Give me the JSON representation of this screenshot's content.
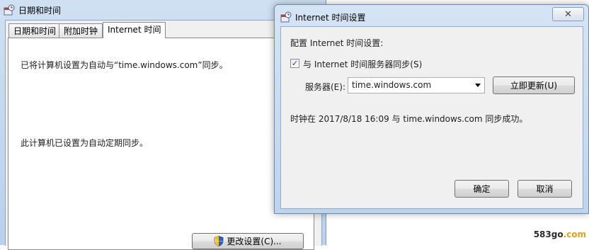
{
  "back_window": {
    "title": "日期和时间",
    "tabs": [
      {
        "label": "日期和时间",
        "active": false
      },
      {
        "label": "附加时钟",
        "active": false
      },
      {
        "label": "Internet 时间",
        "active": true
      }
    ],
    "sync_info": "已将计算机设置为自动与“time.windows.com”同步。",
    "schedule_info": "此计算机已设置为自动定期同步。",
    "change_settings_label": "更改设置(C)..."
  },
  "dialog": {
    "title": "Internet 时间设置",
    "config_label": "配置 Internet 时间设置:",
    "sync_checkbox": {
      "label": "与 Internet 时间服务器同步(S)",
      "checked": true
    },
    "server_label": "服务器(E):",
    "server_value": "time.windows.com",
    "update_now_label": "立即更新(U)",
    "status": "时钟在 2017/8/18 16:09 与 time.windows.com 同步成功。",
    "ok_label": "确定",
    "cancel_label": "取消",
    "close_glyph": "✕"
  },
  "watermark": {
    "main": "583go",
    "sub": ".com"
  }
}
